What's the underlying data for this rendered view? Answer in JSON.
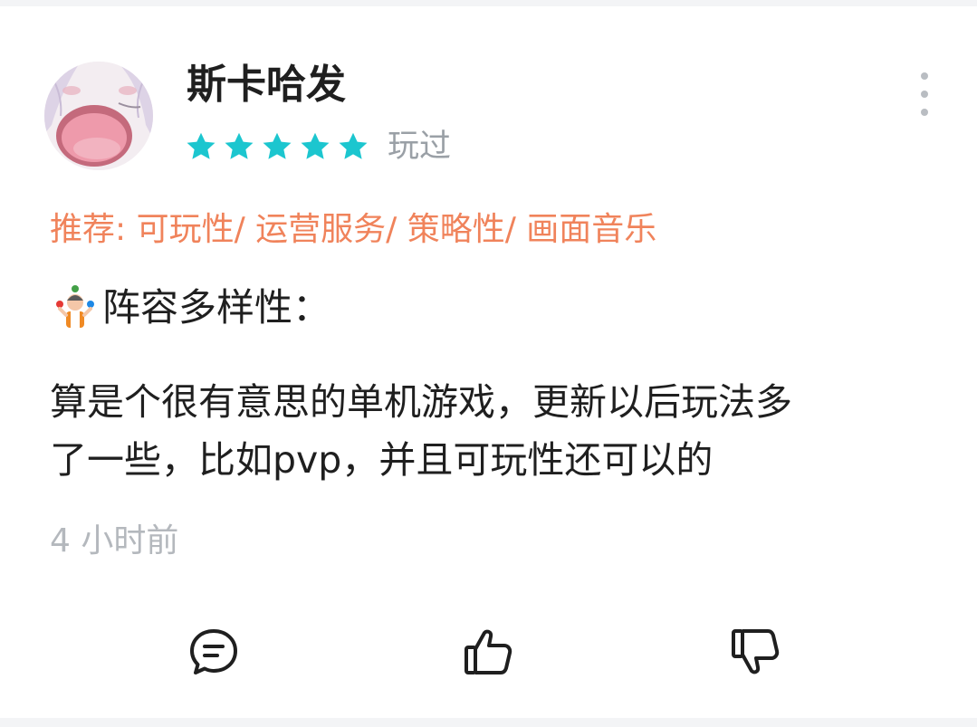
{
  "review": {
    "author": {
      "name": "斯卡哈发",
      "avatar_icon": "anime-girl-avatar"
    },
    "rating": {
      "stars_filled": 5,
      "stars_total": 5,
      "star_color": "#1cc6cf"
    },
    "status": "玩过",
    "recommend": "推荐: 可玩性/ 运营服务/ 策略性/ 画面音乐",
    "section_icon": "juggler-emoji-icon",
    "section_title": "阵容多样性：",
    "body_lines": [
      "算是个很有意思的单机游戏，更新以后玩法多",
      "了一些，比如pvp，并且可玩性还可以的"
    ],
    "timestamp": "4 小时前"
  },
  "actions": {
    "comment_icon": "comment-icon",
    "like_icon": "thumbs-up-icon",
    "dislike_icon": "thumbs-down-icon",
    "more_icon": "more-vertical-icon"
  },
  "colors": {
    "accent_orange": "#f0835b",
    "star_teal": "#1cc6cf",
    "muted_gray": "#9aa0a6"
  }
}
